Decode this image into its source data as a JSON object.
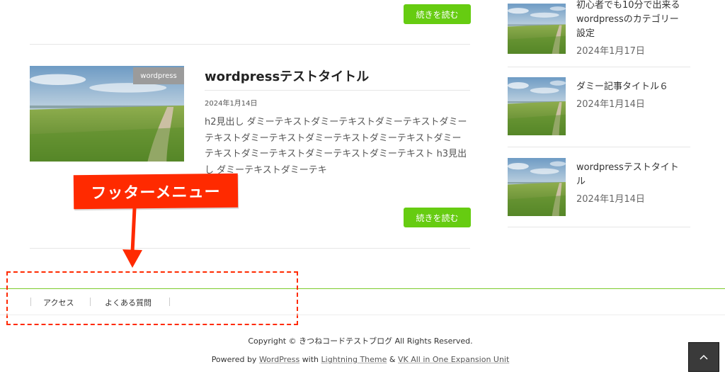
{
  "read_more_label": "続きを読む",
  "post": {
    "category": "wordpress",
    "title": "wordpressテストタイトル",
    "date": "2024年1月14日",
    "excerpt": "h2見出し ダミーテキストダミーテキストダミーテキストダミーテキストダミーテキストダミーテキストダミーテキストダミーテキストダミーテキストダミーテキストダミーテキスト h3見出し ダミーテキストダミーテキ"
  },
  "sidebar": {
    "items": [
      {
        "title_line1": "初心者でも10分で出来る",
        "title_line2": "wordpressのカテゴリー",
        "title_line3": "設定",
        "date": "2024年1月17日"
      },
      {
        "title": "ダミー記事タイトル６",
        "date": "2024年1月14日"
      },
      {
        "title_line1": "wordpressテストタイト",
        "title_line2": "ル",
        "date": "2024年1月14日"
      }
    ]
  },
  "annotation": {
    "label": "フッターメニュー",
    "color": "#ff2a00"
  },
  "footer": {
    "nav": [
      "アクセス",
      "よくある質問"
    ],
    "copyright": "Copyright © きつねコードテストブログ All Rights Reserved.",
    "powered_by": "Powered by",
    "wordpress": "WordPress",
    "with": "with",
    "theme": "Lightning Theme",
    "amp": "&",
    "plugin": "VK All in One Expansion Unit"
  },
  "accent_color": "#66cc11",
  "back_to_top_icon": "chevron-up-icon"
}
